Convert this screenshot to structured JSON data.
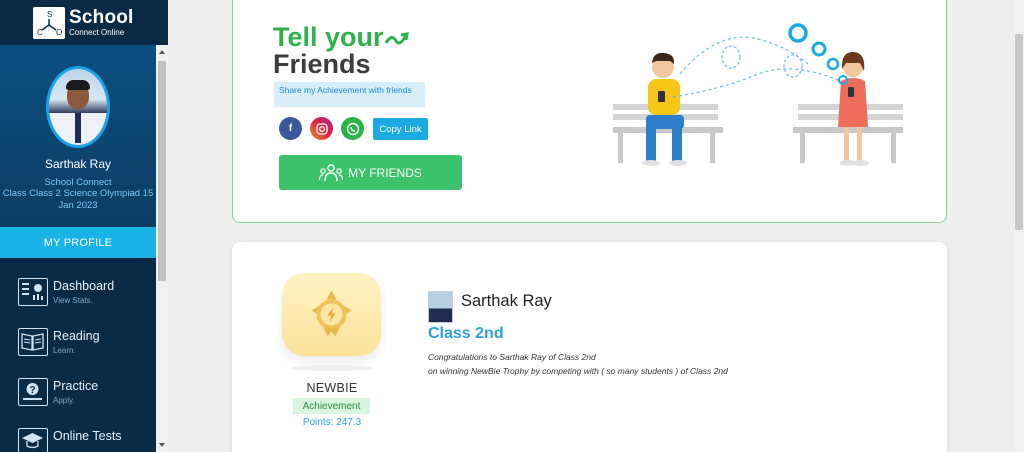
{
  "brand": {
    "name": "School",
    "subtitle": "Connect Online"
  },
  "profile": {
    "name": "Sarthak Ray",
    "school": "School Connect",
    "class_line": "Class Class 2 Science Olympiad 15 Jan 2023",
    "button": "MY PROFILE"
  },
  "nav": [
    {
      "title": "Dashboard",
      "sub": "View Stats.",
      "icon": "dashboard-icon"
    },
    {
      "title": "Reading",
      "sub": "Learn.",
      "icon": "book-icon"
    },
    {
      "title": "Practice",
      "sub": "Apply.",
      "icon": "question-icon"
    },
    {
      "title": "Online Tests",
      "sub": "",
      "icon": "graduation-cap-icon"
    }
  ],
  "share": {
    "heading_1": "Tell your",
    "heading_2": "Friends",
    "label": "Share my Achievement with friends",
    "copy_link": "Copy Link",
    "friends_button": "MY FRIENDS",
    "colors": {
      "accent_green": "#2fb24a",
      "button_green": "#3cc26a",
      "link_blue": "#1aa9e0"
    }
  },
  "achievement": {
    "badge_title": "NEWBIE",
    "badge_type": "Achievement",
    "points": "Points: 247.3",
    "student_name": "Sarthak Ray",
    "student_class": "Class 2nd",
    "congrats_line1": "Congratulations to Sarthak Ray of Class 2nd",
    "congrats_line2": "on winning NewBie Trophy by competing with ( so many students ) of Class 2nd"
  }
}
